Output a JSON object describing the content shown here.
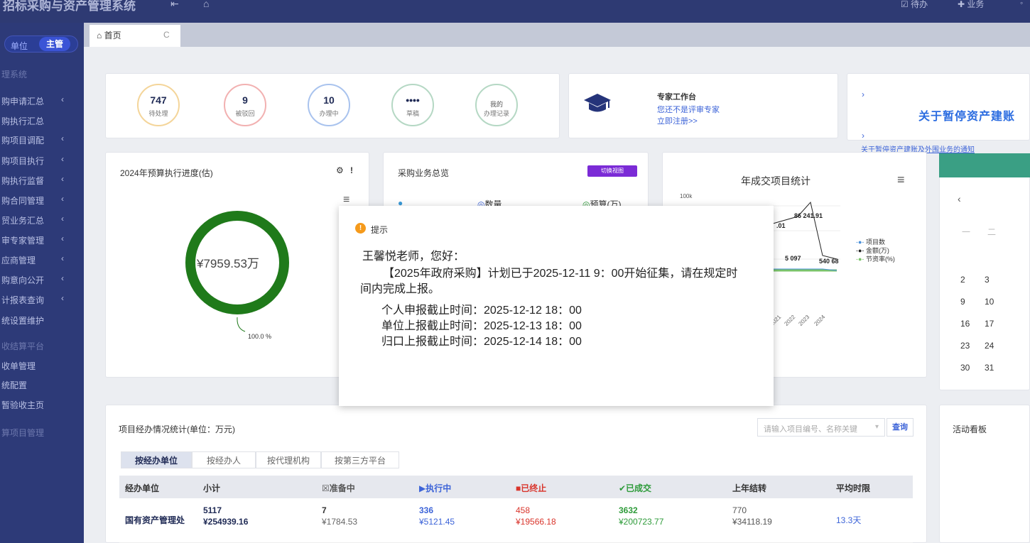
{
  "topbar": {
    "app_title": "招标采购与资产管理系统",
    "btn1": "待办",
    "btn2": "业务"
  },
  "sidebar": {
    "switch_unit": "单位",
    "switch_admin": "主管",
    "items": [
      {
        "label": "理系统",
        "chev": "",
        "section": true
      },
      {
        "label": "购申请汇总",
        "chev": "‹"
      },
      {
        "label": "购执行汇总",
        "chev": ""
      },
      {
        "label": "购项目调配",
        "chev": "‹"
      },
      {
        "label": "购项目执行",
        "chev": "‹"
      },
      {
        "label": "购执行监督",
        "chev": "‹"
      },
      {
        "label": "购合同管理",
        "chev": "‹"
      },
      {
        "label": "贸业务汇总",
        "chev": "‹"
      },
      {
        "label": "审专家管理",
        "chev": "‹"
      },
      {
        "label": "应商管理",
        "chev": "‹"
      },
      {
        "label": "购意向公开",
        "chev": "‹"
      },
      {
        "label": "计报表查询",
        "chev": "‹"
      },
      {
        "label": "统设置维护",
        "chev": ""
      },
      {
        "label": "收结算平台",
        "chev": "",
        "section": true
      },
      {
        "label": "收单管理",
        "chev": ""
      },
      {
        "label": "统配置",
        "chev": ""
      },
      {
        "label": "暂验收主页",
        "chev": ""
      },
      {
        "label": "算项目管理",
        "chev": "",
        "section": true
      }
    ]
  },
  "tabs": {
    "home_label": "首页",
    "refresh_glyph": "C",
    "home_glyph": "⌂"
  },
  "stats": [
    {
      "num": "747",
      "cap": "待处理"
    },
    {
      "num": "9",
      "cap": "被驳回"
    },
    {
      "num": "10",
      "cap": "办理中"
    },
    {
      "num": "••••",
      "cap": "草稿"
    },
    {
      "num": "我的",
      "cap": "办理记录"
    }
  ],
  "expert": {
    "title": "专家工作台",
    "line1": "您还不是评审专家",
    "line2": "立即注册>>"
  },
  "notice": {
    "big": "关于暂停资产建账",
    "small": "关于暂停资产建账及外围业务的通知",
    "arrow": "›"
  },
  "budget_panel": {
    "title": "2024年预算执行进度(估)",
    "amount": "¥7959.53万",
    "percent_label": "100.0 %",
    "progress": 1.0,
    "menu_glyph": "≡"
  },
  "overview_panel": {
    "title": "采购业务总览",
    "badge": "切换视图",
    "col_count": "数量",
    "col_budget": "预算(万)"
  },
  "year_panel": {
    "title": "年成交项目统计",
    "y_tick": "100k",
    "labels": [
      "86 241.91",
      ".01",
      "5 097",
      "540 68"
    ],
    "years": [
      "2021",
      "2022",
      "2023",
      "2024"
    ],
    "legend": [
      {
        "name": "项目数",
        "color": "#4a90d9"
      },
      {
        "name": "金额(万)",
        "color": "#222222"
      },
      {
        "name": "节资率(%)",
        "color": "#7ac36a"
      }
    ]
  },
  "calendar": {
    "prev": "‹",
    "weekdays": [
      "一",
      "二"
    ],
    "rows": [
      [
        "2",
        "3"
      ],
      [
        "9",
        "10"
      ],
      [
        "16",
        "17"
      ],
      [
        "23",
        "24"
      ],
      [
        "30",
        "31"
      ]
    ]
  },
  "activity": {
    "title": "活动看板"
  },
  "project_stats": {
    "title": "项目经办情况统计(单位：万元)",
    "search_placeholder": "请输入项目编号、名称关键",
    "search_btn": "查询",
    "subtabs": [
      "按经办单位",
      "按经办人",
      "按代理机构",
      "按第三方平台"
    ],
    "headers": [
      {
        "label": "经办单位",
        "color": "#333333"
      },
      {
        "label": "小计",
        "color": "#333333"
      },
      {
        "label": "☒准备中",
        "color": "#555555"
      },
      {
        "label": "▶执行中",
        "color": "#3d64d8"
      },
      {
        "label": "■已终止",
        "color": "#d9342b"
      },
      {
        "label": "✔已成交",
        "color": "#2e9b3a"
      },
      {
        "label": "上年结转",
        "color": "#333333"
      },
      {
        "label": "平均时限",
        "color": "#333333"
      }
    ],
    "row": {
      "unit": "国有资产管理处",
      "subtotal_count": "5117",
      "subtotal_amount": "¥254939.16",
      "prep_count": "7",
      "prep_amount": "¥1784.53",
      "exec_count": "336",
      "exec_amount": "¥5121.45",
      "term_count": "458",
      "term_amount": "¥19566.18",
      "done_count": "3632",
      "done_amount": "¥200723.77",
      "carry_count": "770",
      "carry_amount": "¥34118.19",
      "avg": "13.3天"
    }
  },
  "dialog": {
    "icon": "!",
    "title": "提示",
    "greeting": "王馨悦老师，您好：",
    "body1": "【2025年政府采购】计划已于2025-12-11 9：00开始征集，请在规定时",
    "body2": "间内完成上报。",
    "deadline1": "个人申报截止时间：2025-12-12 18：00",
    "deadline2": "单位上报截止时间：2025-12-13 18：00",
    "deadline3": "归口上报截止时间：2025-12-14 18：00"
  },
  "colors": {
    "sidebar_bg": "#2d3a78",
    "topbar_bg": "#2e3a73",
    "donut_green": "#1f7a1a",
    "accent_blue": "#3d64d8"
  }
}
